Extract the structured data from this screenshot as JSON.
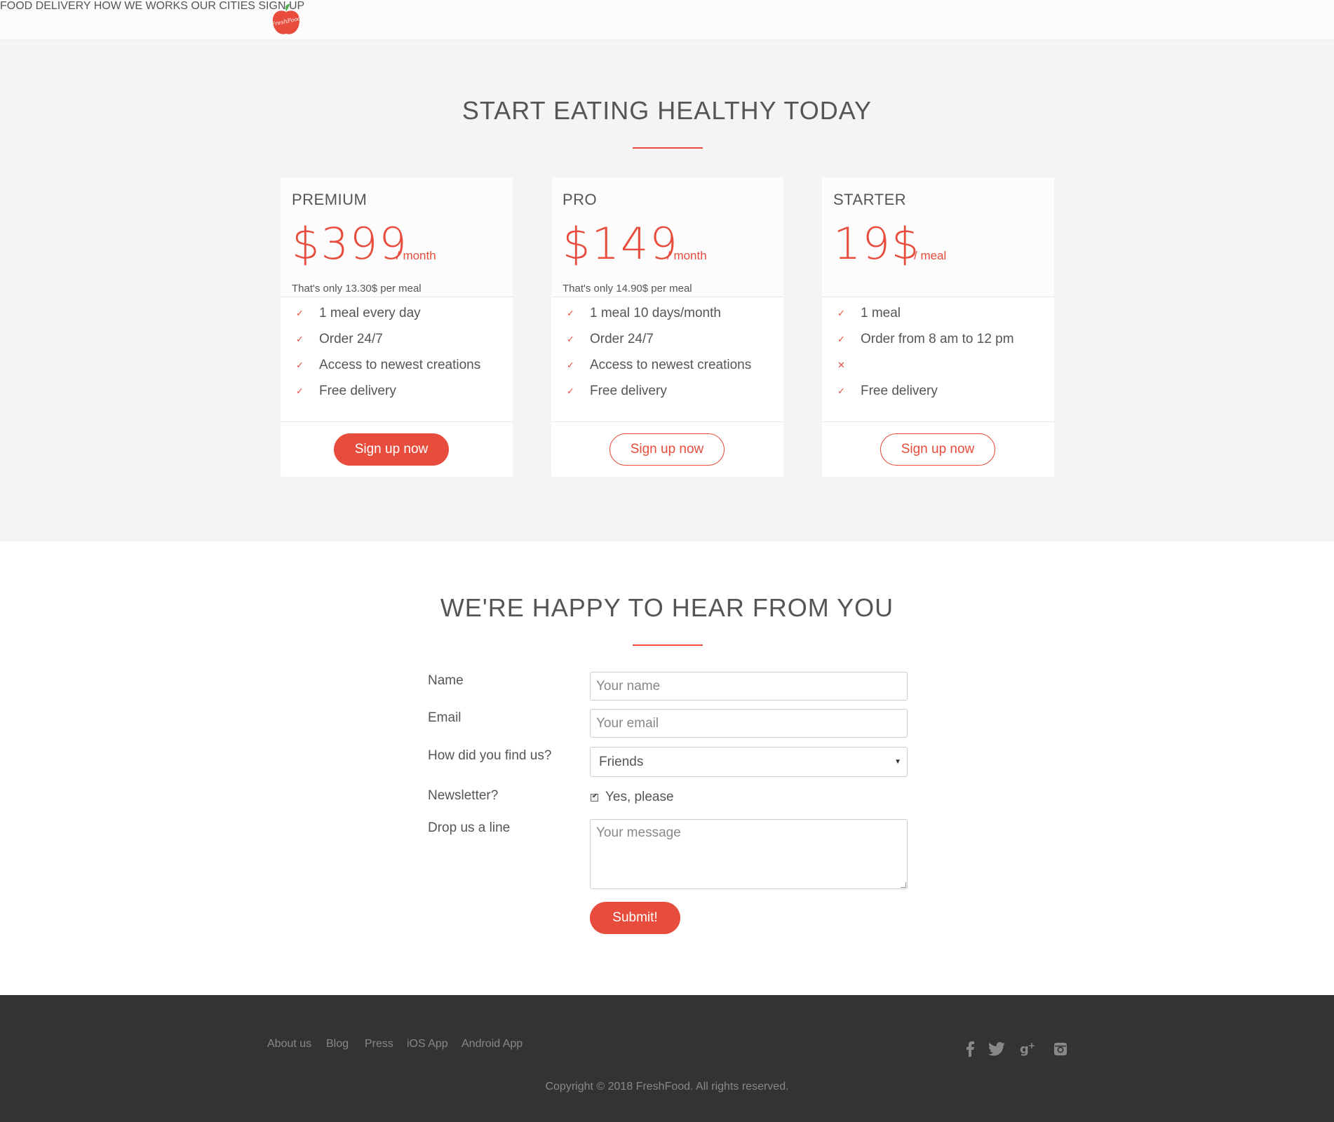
{
  "header": {
    "logo_text": "FreshFood",
    "nav": [
      "FOOD DELIVERY",
      "HOW WE WORKS",
      "OUR CITIES",
      "SIGN UP"
    ]
  },
  "pricing": {
    "title": "START EATING HEALTHY TODAY",
    "plans": [
      {
        "name": "PREMIUM",
        "price": "$399",
        "unit": "/ month",
        "note": "That's only 13.30$ per meal",
        "features": [
          {
            "mark": "✓",
            "text": "1 meal every day"
          },
          {
            "mark": "✓",
            "text": "Order 24/7"
          },
          {
            "mark": "✓",
            "text": "Access to newest creations"
          },
          {
            "mark": "✓",
            "text": "Free delivery"
          }
        ],
        "button": "Sign up now"
      },
      {
        "name": "PRO",
        "price": "$149",
        "unit": "/ month",
        "note": "That's only 14.90$ per meal",
        "features": [
          {
            "mark": "✓",
            "text": "1 meal 10 days/month"
          },
          {
            "mark": "✓",
            "text": "Order 24/7"
          },
          {
            "mark": "✓",
            "text": "Access to newest creations"
          },
          {
            "mark": "✓",
            "text": "Free delivery"
          }
        ],
        "button": "Sign up now"
      },
      {
        "name": "STARTER",
        "price": "19$",
        "unit": "/ meal",
        "note": "",
        "features": [
          {
            "mark": "✓",
            "text": "1 meal"
          },
          {
            "mark": "✓",
            "text": "Order from 8 am to 12 pm"
          },
          {
            "mark": "✕",
            "text": ""
          },
          {
            "mark": "✓",
            "text": "Free delivery"
          }
        ],
        "button": "Sign up now"
      }
    ]
  },
  "contact": {
    "title": "WE'RE HAPPY TO HEAR FROM YOU",
    "name_label": "Name",
    "name_placeholder": "Your name",
    "email_label": "Email",
    "email_placeholder": "Your email",
    "find_label": "How did you find us?",
    "find_value": "Friends",
    "newsletter_label": "Newsletter?",
    "newsletter_option": "Yes, please",
    "message_label": "Drop us a line",
    "message_placeholder": "Your message",
    "submit": "Submit!"
  },
  "footer": {
    "links": [
      "About us",
      "Blog",
      "Press",
      "iOS App",
      "Android App"
    ],
    "social": [
      "facebook-icon",
      "twitter-icon",
      "google-plus-icon",
      "instagram-icon"
    ],
    "copyright": "Copyright © 2018 FreshFood. All rights reserved."
  },
  "colors": {
    "accent": "#e74c3c",
    "footer_bg": "#333333",
    "section_bg": "#f4f4f4"
  }
}
